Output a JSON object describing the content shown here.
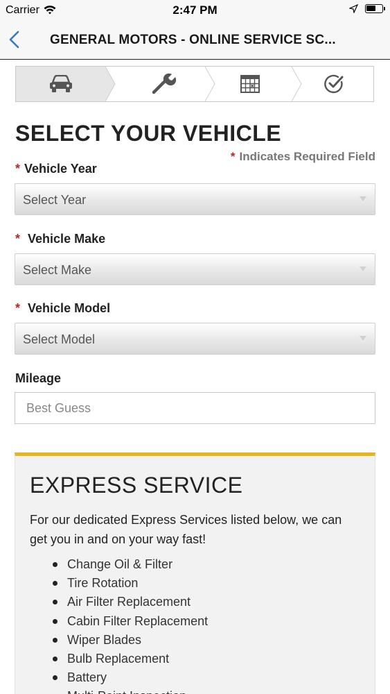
{
  "status_bar": {
    "carrier": "Carrier",
    "time": "2:47 PM",
    "battery_level": 0.6
  },
  "nav": {
    "title": "GENERAL MOTORS - ONLINE SERVICE SC...",
    "back_icon": "chevron-left-icon"
  },
  "steps": [
    {
      "icon": "car-icon",
      "active": true
    },
    {
      "icon": "wrench-icon",
      "active": false
    },
    {
      "icon": "calendar-icon",
      "active": false
    },
    {
      "icon": "checkmark-circle-icon",
      "active": false
    }
  ],
  "form": {
    "heading": "SELECT YOUR VEHICLE",
    "required_star": "*",
    "required_note": "Indicates Required Field",
    "year_label": "Vehicle Year",
    "year_value": "Select Year",
    "make_label": "Vehicle Make",
    "make_value": "Select Make",
    "model_label": "Vehicle Model",
    "model_value": "Select Model",
    "mileage_label": "Mileage",
    "mileage_placeholder": "Best Guess"
  },
  "express": {
    "title": "EXPRESS SERVICE",
    "description": "For our dedicated Express Services listed below, we can get you in and on your way fast!",
    "items": [
      "Change Oil & Filter",
      "Tire Rotation",
      "Air Filter Replacement",
      "Cabin Filter Replacement",
      "Wiper Blades",
      "Bulb Replacement",
      "Battery",
      "Multi-Point Inspection"
    ]
  },
  "colors": {
    "accent_yellow": "#e8b419",
    "required_red": "#b02a2a",
    "ios_blue": "#3478c6"
  }
}
